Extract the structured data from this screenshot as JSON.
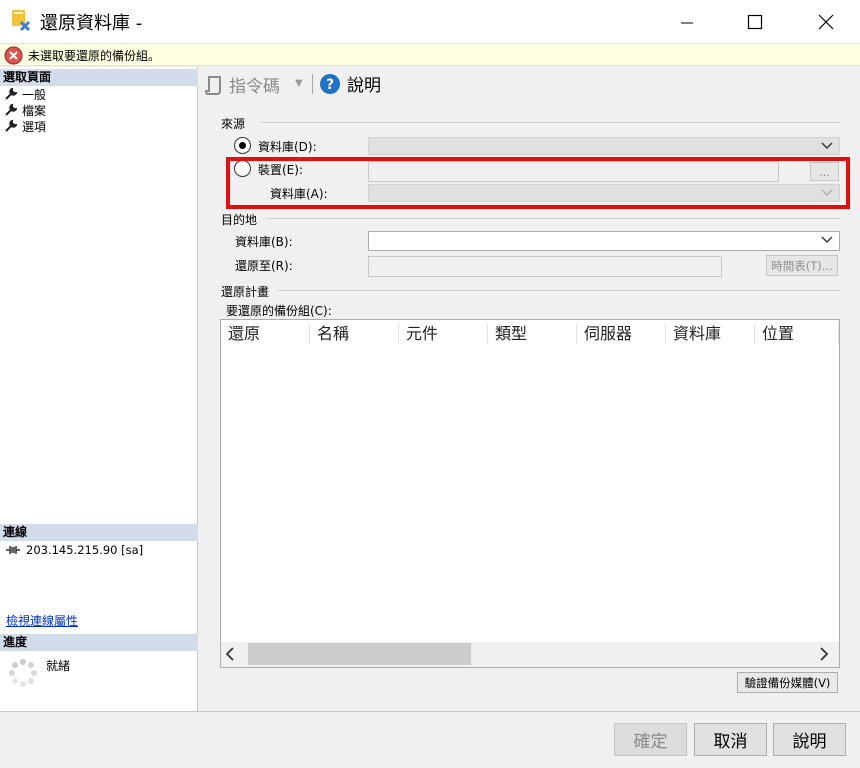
{
  "window": {
    "title": "還原資料庫 -",
    "app_icon": "restore-database-icon",
    "controls": [
      "minimize-icon",
      "maximize-icon",
      "close-icon"
    ]
  },
  "error_bar": {
    "icon": "error-icon",
    "message": "未選取要還原的備份組。"
  },
  "left_pane": {
    "select_page_header": "選取頁面",
    "pages": [
      {
        "label": "一般",
        "icon": "wrench-icon"
      },
      {
        "label": "檔案",
        "icon": "wrench-icon"
      },
      {
        "label": "選項",
        "icon": "wrench-icon"
      }
    ],
    "connection_header": "連線",
    "connection": "203.145.215.90 [sa]",
    "connection_icon": "connection-icon",
    "view_connection_link": "檢視連線屬性",
    "progress_header": "進度",
    "progress_status": "就緒",
    "progress_icon": "spinner-icon"
  },
  "toolbar": {
    "script_label": "指令碼",
    "script_icon": "script-icon",
    "help_label": "說明",
    "help_icon": "help-icon"
  },
  "source": {
    "title": "來源",
    "database_radio": "資料庫(D):",
    "database_selected": true,
    "device_radio": "裝置(E):",
    "device_selected": false,
    "device_browse": "...",
    "device_database_label": "資料庫(A):"
  },
  "destination": {
    "title": "目的地",
    "database_label": "資料庫(B):",
    "restore_to_label": "還原至(R):",
    "timeline_button": "時間表(T)..."
  },
  "restore_plan": {
    "title": "還原計畫",
    "backup_sets_label": "要還原的備份組(C):",
    "columns": [
      "還原",
      "名稱",
      "元件",
      "類型",
      "伺服器",
      "資料庫",
      "位置"
    ],
    "rows": []
  },
  "verify_button": "驗證備份媒體(V)",
  "buttons": {
    "ok": "確定",
    "cancel": "取消",
    "help": "說明"
  },
  "colors": {
    "highlight": "#e01010",
    "section_header": "#d3dceb",
    "error_bar": "#ffffe1",
    "help_blue": "#1e72c8"
  }
}
